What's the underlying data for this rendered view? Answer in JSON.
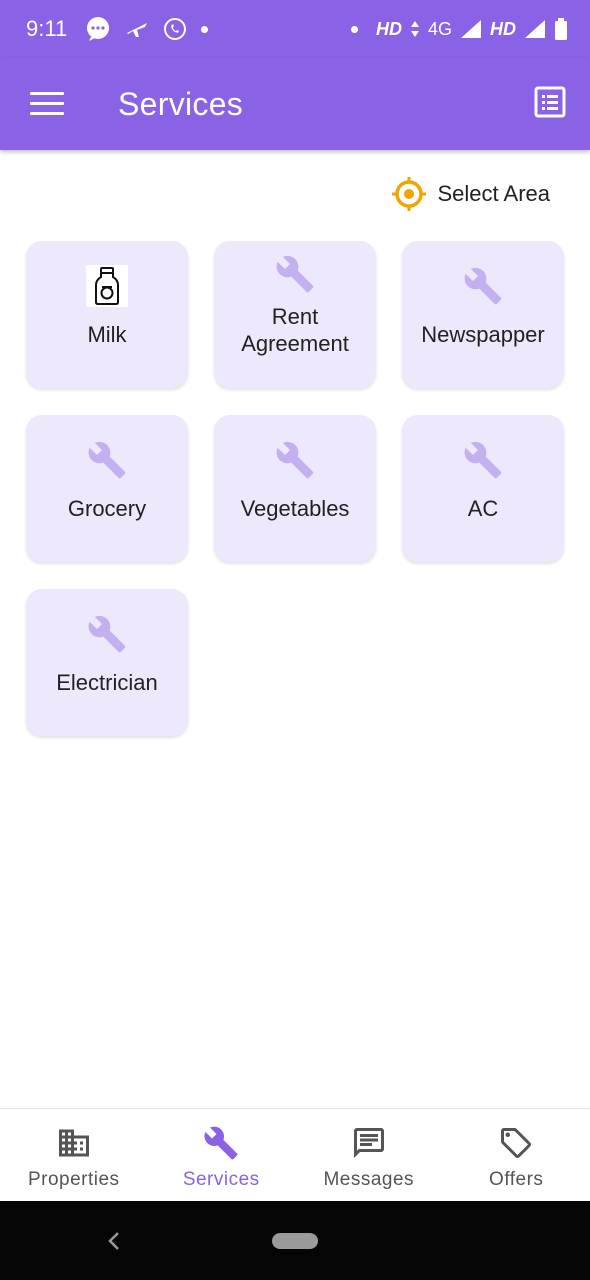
{
  "status_bar": {
    "time": "9:11",
    "network_1": "HD",
    "network_2": "4G",
    "network_3": "HD",
    "icons": [
      "chat-bubble-icon",
      "plane-icon",
      "phone-icon",
      "dot-icon",
      "dot-icon",
      "data-arrows-icon",
      "signal-icon",
      "signal-icon",
      "battery-icon"
    ]
  },
  "app_bar": {
    "title": "Services",
    "menu_icon": "hamburger-menu-icon",
    "action_icon": "list-view-icon"
  },
  "filter": {
    "label": "Select Area",
    "icon": "location-target-icon",
    "icon_color": "#f0a500"
  },
  "services": [
    {
      "label": "Milk",
      "icon": "milk-bottle-icon"
    },
    {
      "label": "Rent Agreement",
      "icon": "wrench-icon"
    },
    {
      "label": "Newspapper",
      "icon": "wrench-icon"
    },
    {
      "label": "Grocery",
      "icon": "wrench-icon"
    },
    {
      "label": "Vegetables",
      "icon": "wrench-icon"
    },
    {
      "label": "AC",
      "icon": "wrench-icon"
    },
    {
      "label": "Electrician",
      "icon": "wrench-icon"
    }
  ],
  "bottom_nav": {
    "items": [
      {
        "label": "Properties",
        "icon": "building-icon",
        "active": false
      },
      {
        "label": "Services",
        "icon": "wrench-icon",
        "active": true
      },
      {
        "label": "Messages",
        "icon": "message-icon",
        "active": false
      },
      {
        "label": "Offers",
        "icon": "tag-icon",
        "active": false
      }
    ]
  },
  "colors": {
    "primary": "#8a62e6",
    "card_bg": "#eee8fd",
    "icon_muted": "#c4b0f0",
    "accent": "#f0a500"
  }
}
